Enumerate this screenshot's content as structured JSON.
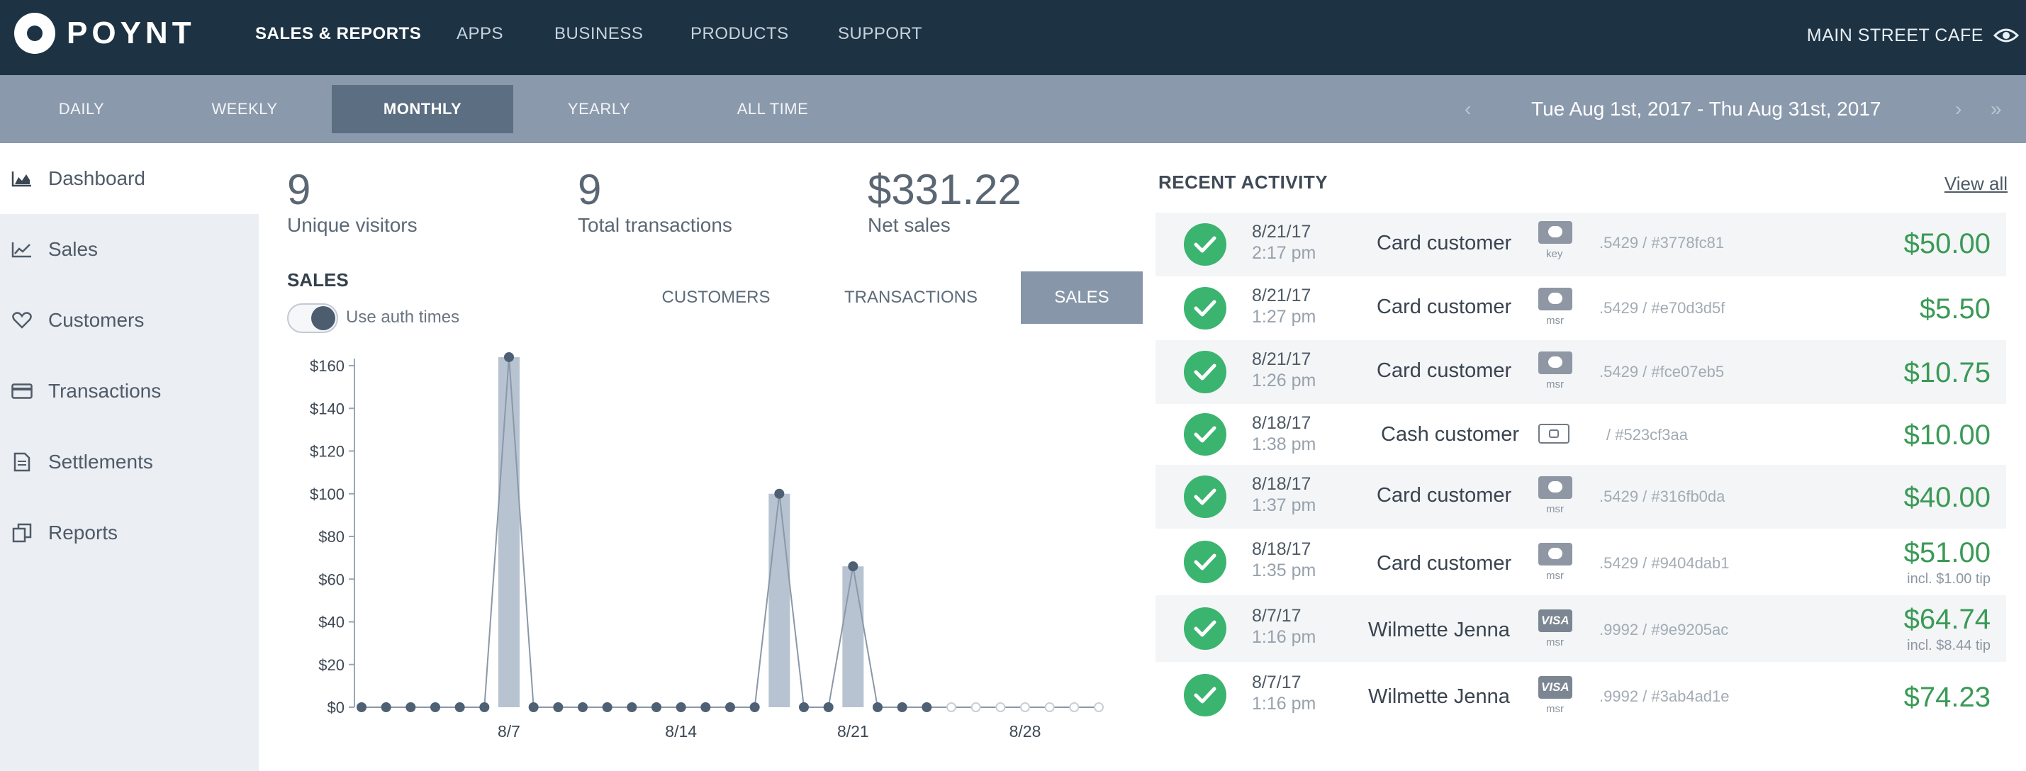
{
  "brand": {
    "name": "POYNT"
  },
  "nav": {
    "items": [
      {
        "label": "SALES & REPORTS",
        "active": true
      },
      {
        "label": "APPS"
      },
      {
        "label": "BUSINESS"
      },
      {
        "label": "PRODUCTS"
      },
      {
        "label": "SUPPORT"
      }
    ],
    "store": "MAIN STREET CAFE",
    "store_icon": "eye-icon"
  },
  "periods": {
    "items": [
      {
        "label": "DAILY"
      },
      {
        "label": "WEEKLY"
      },
      {
        "label": "MONTHLY",
        "active": true
      },
      {
        "label": "YEARLY"
      },
      {
        "label": "ALL TIME"
      }
    ],
    "date_range": "Tue Aug 1st, 2017 - Thu Aug 31st, 2017",
    "prev_icon": "chevron-left-icon",
    "next_icon": "chevron-right-icon",
    "last_icon": "double-chevron-right-icon"
  },
  "sidebar": {
    "items": [
      {
        "label": "Dashboard",
        "icon": "area-chart-icon",
        "active": true
      },
      {
        "label": "Sales",
        "icon": "line-chart-icon"
      },
      {
        "label": "Customers",
        "icon": "heart-icon"
      },
      {
        "label": "Transactions",
        "icon": "credit-card-icon"
      },
      {
        "label": "Settlements",
        "icon": "document-icon"
      },
      {
        "label": "Reports",
        "icon": "copy-icon"
      }
    ]
  },
  "stats": {
    "visitors": {
      "value": "9",
      "label": "Unique visitors"
    },
    "transactions": {
      "value": "9",
      "label": "Total transactions"
    },
    "net_sales": {
      "value": "$331.22",
      "label": "Net sales"
    }
  },
  "sales_panel": {
    "title": "SALES",
    "toggle_label": "Use auth times",
    "toggle_on": true,
    "tabs": [
      {
        "label": "CUSTOMERS"
      },
      {
        "label": "TRANSACTIONS"
      },
      {
        "label": "SALES",
        "active": true
      }
    ]
  },
  "chart_data": {
    "type": "bar",
    "x": [
      1,
      2,
      3,
      4,
      5,
      6,
      7,
      8,
      9,
      10,
      11,
      12,
      13,
      14,
      15,
      16,
      17,
      18,
      19,
      20,
      21,
      22,
      23,
      24,
      25,
      26,
      27,
      28,
      29,
      30,
      31
    ],
    "values": [
      0,
      0,
      0,
      0,
      0,
      0,
      164,
      0,
      0,
      0,
      0,
      0,
      0,
      0,
      0,
      0,
      0,
      100,
      0,
      0,
      66,
      0,
      0,
      0,
      0,
      0,
      0,
      0,
      0,
      0,
      0
    ],
    "future_from_day": 25,
    "y_ticks": [
      "$0",
      "$20",
      "$40",
      "$60",
      "$80",
      "$100",
      "$120",
      "$140",
      "$160"
    ],
    "x_ticks": [
      {
        "day": 7,
        "label": "8/7"
      },
      {
        "day": 14,
        "label": "8/14"
      },
      {
        "day": 21,
        "label": "8/21"
      },
      {
        "day": 28,
        "label": "8/28"
      }
    ],
    "ylim": [
      0,
      160
    ],
    "grid": false,
    "bar_color": "#b7c3d0",
    "line_color": "#8a98a8",
    "point_color": "#4e6074"
  },
  "activity": {
    "title": "RECENT ACTIVITY",
    "view_all": "View all",
    "rows": [
      {
        "date": "8/21/17",
        "time": "2:17 pm",
        "name": "Card customer",
        "card": "card",
        "source": "key",
        "ref": ".5429 / #3778fc81",
        "amount": "$50.00",
        "tip": "",
        "status_icon": "check-circle-icon"
      },
      {
        "date": "8/21/17",
        "time": "1:27 pm",
        "name": "Card customer",
        "card": "card",
        "source": "msr",
        "ref": ".5429 / #e70d3d5f",
        "amount": "$5.50",
        "tip": "",
        "status_icon": "check-circle-icon"
      },
      {
        "date": "8/21/17",
        "time": "1:26 pm",
        "name": "Card customer",
        "card": "card",
        "source": "msr",
        "ref": ".5429 / #fce07eb5",
        "amount": "$10.75",
        "tip": "",
        "status_icon": "check-circle-icon"
      },
      {
        "date": "8/18/17",
        "time": "1:38 pm",
        "name": "Cash customer",
        "card": "cash",
        "source": "",
        "ref": "/ #523cf3aa",
        "amount": "$10.00",
        "tip": "",
        "status_icon": "check-circle-icon"
      },
      {
        "date": "8/18/17",
        "time": "1:37 pm",
        "name": "Card customer",
        "card": "card",
        "source": "msr",
        "ref": ".5429 / #316fb0da",
        "amount": "$40.00",
        "tip": "",
        "status_icon": "check-circle-icon"
      },
      {
        "date": "8/18/17",
        "time": "1:35 pm",
        "name": "Card customer",
        "card": "card",
        "source": "msr",
        "ref": ".5429 / #9404dab1",
        "amount": "$51.00",
        "tip": "incl. $1.00 tip",
        "status_icon": "check-circle-icon"
      },
      {
        "date": "8/7/17",
        "time": "1:16 pm",
        "name": "Wilmette Jenna",
        "card": "visa",
        "card_text": "VISA",
        "source": "msr",
        "ref": ".9992 / #9e9205ac",
        "amount": "$64.74",
        "tip": "incl. $8.44 tip",
        "status_icon": "check-circle-icon"
      },
      {
        "date": "8/7/17",
        "time": "1:16 pm",
        "name": "Wilmette Jenna",
        "card": "visa",
        "card_text": "VISA",
        "source": "msr",
        "ref": ".9992 / #3ab4ad1e",
        "amount": "$74.23",
        "tip": "",
        "status_icon": "check-circle-icon"
      }
    ]
  }
}
